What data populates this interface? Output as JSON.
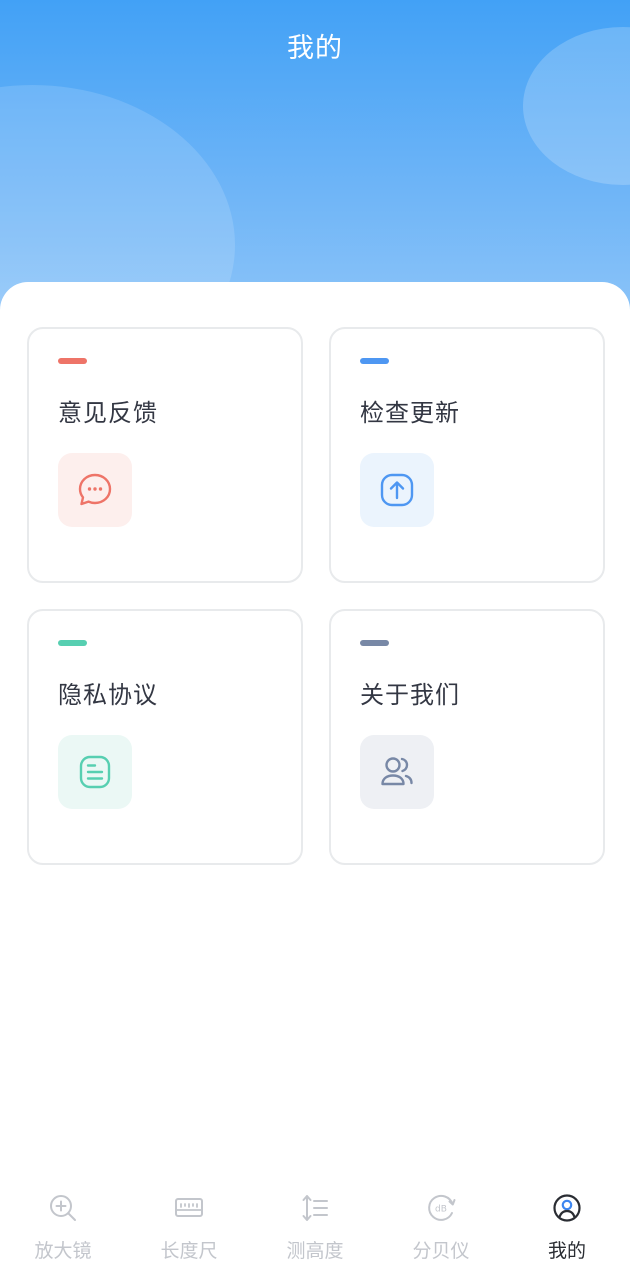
{
  "header": {
    "title": "我的"
  },
  "cards": [
    {
      "label": "意见反馈",
      "accent": "#ee7468",
      "icon": "chat-bubble-icon",
      "icon_bg": "#fdefed"
    },
    {
      "label": "检查更新",
      "accent": "#4e97f2",
      "icon": "upload-arrow-icon",
      "icon_bg": "#ebf4fd"
    },
    {
      "label": "隐私协议",
      "accent": "#57cfb1",
      "icon": "document-icon",
      "icon_bg": "#ebf8f5"
    },
    {
      "label": "关于我们",
      "accent": "#7888a6",
      "icon": "users-icon",
      "icon_bg": "#eef0f4"
    }
  ],
  "tabbar": {
    "items": [
      {
        "label": "放大镜",
        "icon": "magnifier-icon",
        "active": false
      },
      {
        "label": "长度尺",
        "icon": "ruler-icon",
        "active": false
      },
      {
        "label": "测高度",
        "icon": "height-icon",
        "active": false
      },
      {
        "label": "分贝仪",
        "icon": "decibel-icon",
        "active": false
      },
      {
        "label": "我的",
        "icon": "profile-icon",
        "active": true
      }
    ]
  }
}
